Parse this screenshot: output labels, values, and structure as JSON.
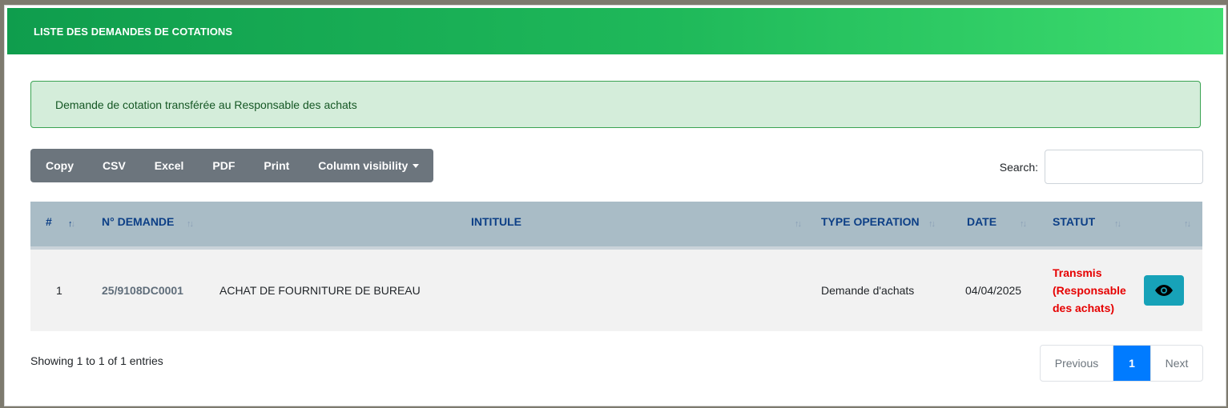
{
  "header": {
    "title": "LISTE DES DEMANDES DE COTATIONS"
  },
  "alert": {
    "message": "Demande de cotation transférée au Responsable des achats"
  },
  "toolbar": {
    "buttons": [
      "Copy",
      "CSV",
      "Excel",
      "PDF",
      "Print",
      "Column visibility"
    ]
  },
  "search": {
    "label": "Search:",
    "value": "",
    "placeholder": ""
  },
  "table": {
    "columns": [
      "#",
      "N° DEMANDE",
      "INTITULE",
      "TYPE OPERATION",
      "DATE",
      "STATUT",
      ""
    ],
    "rows": [
      {
        "index": "1",
        "numero": "25/9108DC0001",
        "intitule": "ACHAT DE FOURNITURE DE BUREAU",
        "type_operation": "Demande d'achats",
        "date": "04/04/2025",
        "statut_lines": [
          "Transmis",
          "(Responsable",
          "des achats)"
        ],
        "action_icon": "eye-icon"
      }
    ]
  },
  "footer": {
    "info": "Showing 1 to 1 of 1 entries",
    "pagination": {
      "previous": "Previous",
      "current": "1",
      "next": "Next"
    }
  },
  "colors": {
    "header_gradient_start": "#0f9d4d",
    "header_gradient_end": "#3ddc6e",
    "alert_bg": "#d4edda",
    "status_color": "#e60000",
    "action_button": "#17a2b8",
    "pagination_active": "#007bff"
  }
}
